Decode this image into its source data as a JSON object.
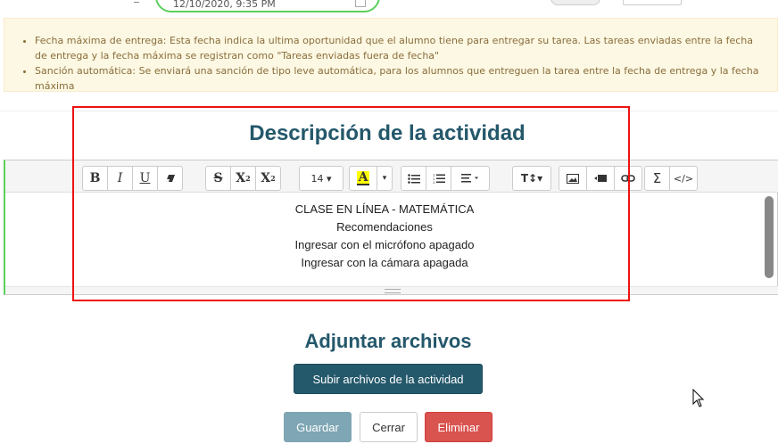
{
  "top": {
    "date_value": "12/10/2020, 9:35 PM"
  },
  "info": {
    "items": [
      "Fecha máxima de entrega: Esta fecha indica la ultima oportunidad que el alumno tiene para entregar su tarea. Las tareas enviadas entre la fecha de entrega y la fecha máxima se registran como \"Tareas enviadas fuera de fecha\"",
      "Sanción automática: Se enviará una sanción de tipo leve automática, para los alumnos que entreguen la tarea entre la fecha de entrega y la fecha máxima"
    ]
  },
  "description": {
    "title": "Descripción de la actividad",
    "toolbar": {
      "bold": "B",
      "italic": "I",
      "underline": "U",
      "strike": "S",
      "superscript": "X",
      "subscript": "X",
      "font_size": "14 ▾",
      "highlight": "A",
      "text_height": "T↕▾",
      "sigma": "Σ",
      "code": "</>"
    },
    "content": [
      "CLASE EN LÍNEA - MATEMÁTICA",
      "Recomendaciones",
      "Ingresar con el micrófono apagado",
      "Ingresar con la cámara apagada"
    ]
  },
  "attachments": {
    "title": "Adjuntar archivos",
    "upload_label": "Subir archivos de la actividad"
  },
  "actions": {
    "save": "Guardar",
    "close": "Cerrar",
    "delete": "Eliminar"
  },
  "colors": {
    "accent": "#24586b",
    "highlight_box": "#e11111",
    "danger": "#d9534f"
  }
}
